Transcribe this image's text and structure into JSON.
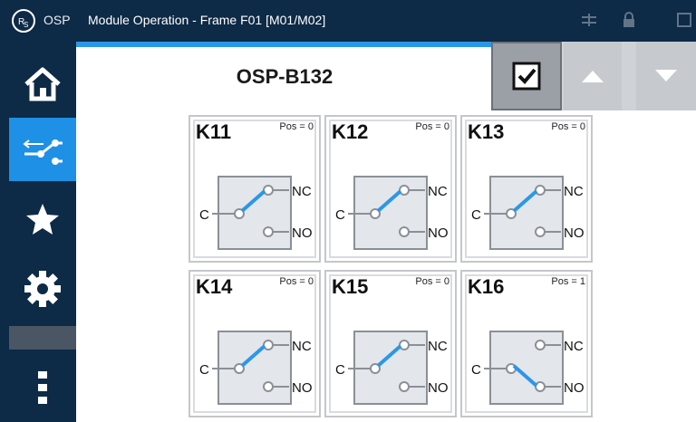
{
  "titlebar": {
    "app_name": "OSP",
    "window_title": "Module Operation - Frame F01 [M01/M02]"
  },
  "sidebar": {
    "items": [
      {
        "name": "home",
        "icon": "home-icon",
        "active": false
      },
      {
        "name": "switch",
        "icon": "switch-icon",
        "active": true
      },
      {
        "name": "favorites",
        "icon": "star-icon",
        "active": false
      },
      {
        "name": "settings",
        "icon": "gear-icon",
        "active": false
      },
      {
        "name": "more",
        "icon": "more-vertical-icon",
        "active": false
      }
    ]
  },
  "header": {
    "title": "OSP-B132",
    "buttons": [
      "checkbox-icon",
      "arrow-up-icon",
      "arrow-down-icon"
    ]
  },
  "colors": {
    "navy": "#0d2a46",
    "accent_blue": "#1e90e6",
    "switch_blue": "#2b97e8",
    "panel_grey": "#e3e6ea"
  },
  "relays": [
    {
      "name": "K11",
      "pos": "Pos = 0",
      "label_c": "C",
      "label_nc": "NC",
      "label_no": "NO",
      "state": 0
    },
    {
      "name": "K12",
      "pos": "Pos = 0",
      "label_c": "C",
      "label_nc": "NC",
      "label_no": "NO",
      "state": 0
    },
    {
      "name": "K13",
      "pos": "Pos = 0",
      "label_c": "C",
      "label_nc": "NC",
      "label_no": "NO",
      "state": 0
    },
    {
      "name": "K14",
      "pos": "Pos = 0",
      "label_c": "C",
      "label_nc": "NC",
      "label_no": "NO",
      "state": 0
    },
    {
      "name": "K15",
      "pos": "Pos = 0",
      "label_c": "C",
      "label_nc": "NC",
      "label_no": "NO",
      "state": 0
    },
    {
      "name": "K16",
      "pos": "Pos = 1",
      "label_c": "C",
      "label_nc": "NC",
      "label_no": "NO",
      "state": 1
    }
  ]
}
